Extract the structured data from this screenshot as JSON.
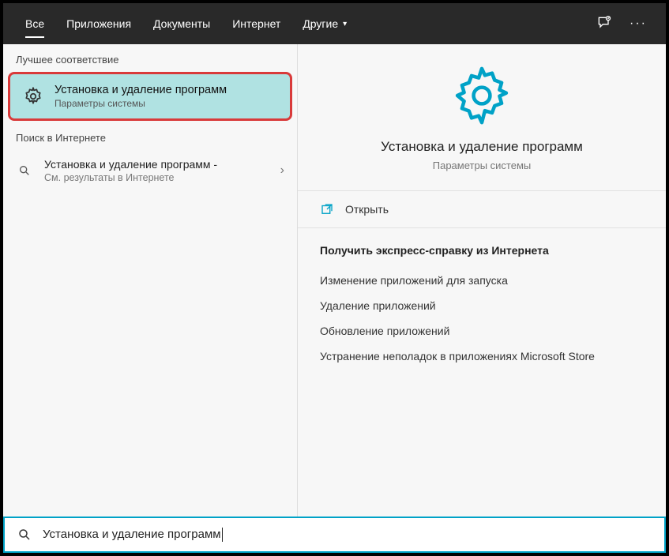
{
  "topbar": {
    "tabs": [
      {
        "label": "Все",
        "active": true
      },
      {
        "label": "Приложения"
      },
      {
        "label": "Документы"
      },
      {
        "label": "Интернет"
      },
      {
        "label": "Другие",
        "caret": true
      }
    ]
  },
  "left": {
    "best_match_label": "Лучшее соответствие",
    "best_match": {
      "title": "Установка и удаление программ",
      "subtitle": "Параметры системы"
    },
    "web_label": "Поиск в Интернете",
    "web_result": {
      "title": "Установка и удаление программ -",
      "subtitle": "См. результаты в Интернете"
    }
  },
  "right": {
    "title": "Установка и удаление программ",
    "subtitle": "Параметры системы",
    "open_label": "Открыть",
    "help_heading": "Получить экспресс-справку из Интернета",
    "help_links": [
      "Изменение приложений для запуска",
      "Удаление приложений",
      "Обновление приложений",
      "Устранение неполадок в приложениях Microsoft Store"
    ]
  },
  "search": {
    "value": "Установка и удаление программ"
  }
}
